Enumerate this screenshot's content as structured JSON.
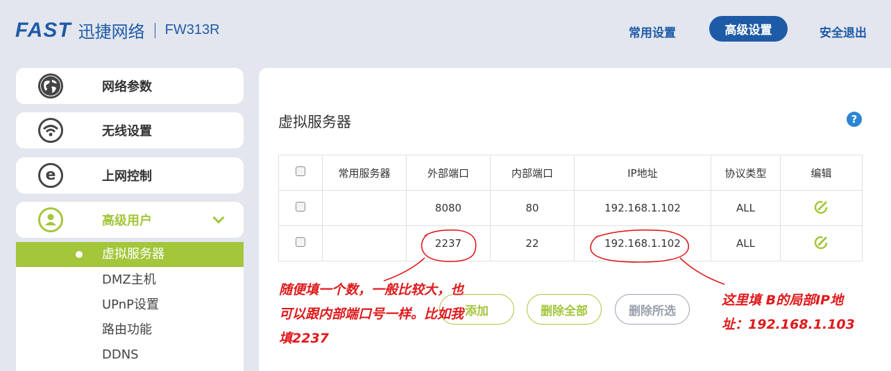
{
  "brand": {
    "logo": "FAST",
    "name_cn": "迅捷网络",
    "model": "FW313R"
  },
  "topnav": {
    "common": "常用设置",
    "advanced": "高级设置",
    "logout": "安全退出"
  },
  "sidebar": {
    "items": [
      {
        "label": "网络参数",
        "icon": "globe-icon"
      },
      {
        "label": "无线设置",
        "icon": "wifi-icon"
      },
      {
        "label": "上网控制",
        "icon": "ie-icon"
      },
      {
        "label": "高级用户",
        "icon": "user-icon"
      }
    ],
    "submenu": [
      "虚拟服务器",
      "DMZ主机",
      "UPnP设置",
      "路由功能",
      "DDNS"
    ]
  },
  "main": {
    "title": "虚拟服务器",
    "help": "?",
    "table": {
      "headers": [
        "常用服务器",
        "外部端口",
        "内部端口",
        "IP地址",
        "协议类型",
        "编辑"
      ],
      "rows": [
        {
          "service": "",
          "ext_port": "8080",
          "int_port": "80",
          "ip": "192.168.1.102",
          "protocol": "ALL"
        },
        {
          "service": "",
          "ext_port": "2237",
          "int_port": "22",
          "ip": "192.168.1.102",
          "protocol": "ALL"
        }
      ]
    },
    "buttons": {
      "add": "添加",
      "delete_all": "删除全部",
      "delete_selected": "删除所选"
    }
  },
  "annotations": {
    "left": "随便填一个数，一般比较大，也可以跟内部端口号一样。比如我填2237",
    "right": "这里填 B的局部IP地址：192.168.1.103"
  },
  "colors": {
    "brand_blue": "#1e5ba6",
    "accent_green": "#a3c63b",
    "annotation_red": "#e0191b"
  }
}
